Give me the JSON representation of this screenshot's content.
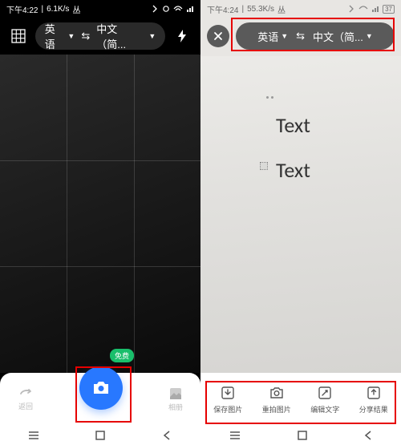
{
  "left": {
    "status": {
      "time": "下午4:22",
      "speed": "6.1K/s",
      "icons": "⚡⚪📶📶"
    },
    "topbar": {
      "source_lang": "英语",
      "target_lang": "中文（简...",
      "swap": "⇆"
    },
    "bottom": {
      "back_label": "返回",
      "gallery_label": "相册",
      "free_badge": "免费"
    }
  },
  "right": {
    "status": {
      "time": "下午4:24",
      "speed": "55.3K/s",
      "icons": "⚡⚪📶📶 37"
    },
    "topbar": {
      "source_lang": "英语",
      "target_lang": "中文（简...",
      "swap": "⇆"
    },
    "content": {
      "text1": "Text",
      "text2": "Text"
    },
    "actions": {
      "save": "保存图片",
      "recapture": "重拍图片",
      "edit": "编辑文字",
      "share": "分享结果"
    }
  }
}
